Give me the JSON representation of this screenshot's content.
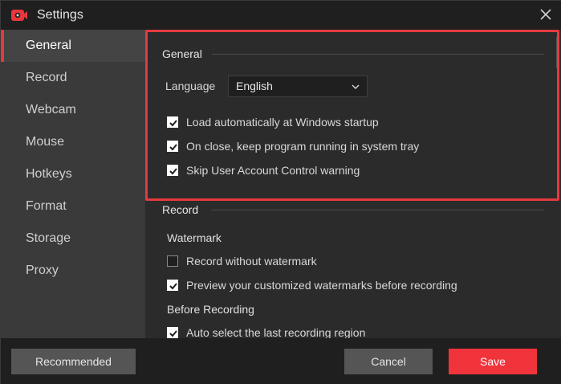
{
  "window": {
    "title": "Settings"
  },
  "sidebar": {
    "items": [
      {
        "label": "General",
        "active": true
      },
      {
        "label": "Record"
      },
      {
        "label": "Webcam"
      },
      {
        "label": "Mouse"
      },
      {
        "label": "Hotkeys"
      },
      {
        "label": "Format"
      },
      {
        "label": "Storage"
      },
      {
        "label": "Proxy"
      }
    ]
  },
  "general": {
    "title": "General",
    "language_label": "Language",
    "language_value": "English",
    "options": [
      {
        "label": "Load automatically at Windows startup",
        "checked": true
      },
      {
        "label": "On close, keep program running in system tray",
        "checked": true
      },
      {
        "label": "Skip User Account Control warning",
        "checked": true
      }
    ]
  },
  "record": {
    "title": "Record",
    "watermark_title": "Watermark",
    "watermark_options": [
      {
        "label": "Record without watermark",
        "checked": false
      },
      {
        "label": "Preview your customized watermarks before recording",
        "checked": true
      }
    ],
    "before_title": "Before Recording",
    "before_options": [
      {
        "label": "Auto select the last recording region",
        "checked": true
      }
    ]
  },
  "footer": {
    "recommended": "Recommended",
    "cancel": "Cancel",
    "save": "Save"
  },
  "colors": {
    "accent": "#f1333b",
    "highlight": "#e53a40"
  }
}
